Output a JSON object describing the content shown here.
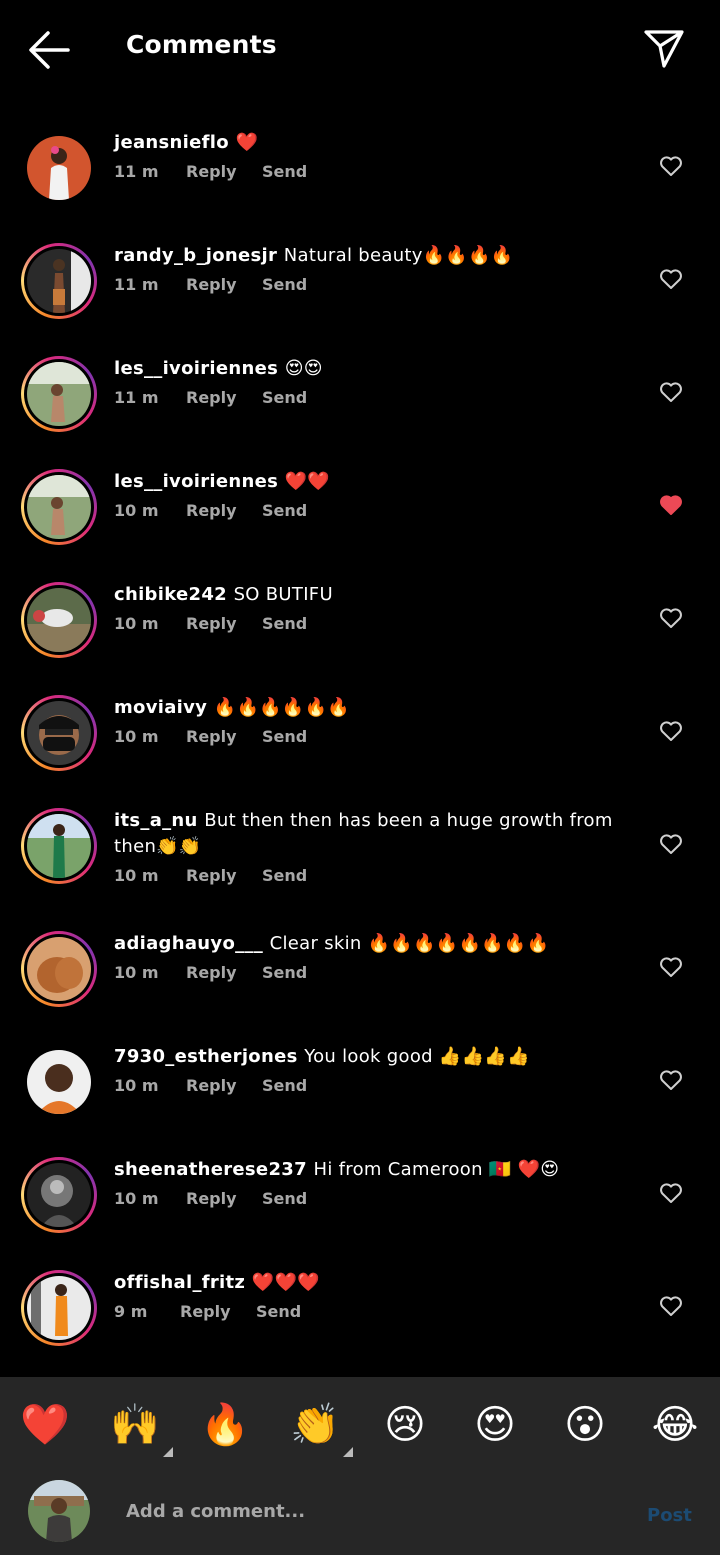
{
  "header": {
    "title": "Comments",
    "back_icon": "arrow-left-icon",
    "share_icon": "paper-plane-icon"
  },
  "comments": [
    {
      "user": "jeansnieflo",
      "text": "❤️",
      "time": "11 m",
      "reply": "Reply",
      "send": "Send",
      "liked": false,
      "ring": false
    },
    {
      "user": "randy_b_jonesjr",
      "text": "Natural beauty🔥🔥🔥🔥",
      "time": "11 m",
      "reply": "Reply",
      "send": "Send",
      "liked": false,
      "ring": true
    },
    {
      "user": "les__ivoiriennes",
      "text": "😍😍",
      "time": "11 m",
      "reply": "Reply",
      "send": "Send",
      "liked": false,
      "ring": true
    },
    {
      "user": "les__ivoiriennes",
      "text": "❤️❤️",
      "time": "10 m",
      "reply": "Reply",
      "send": "Send",
      "liked": true,
      "ring": true
    },
    {
      "user": "chibike242",
      "text": "SO BUTIFU",
      "time": "10 m",
      "reply": "Reply",
      "send": "Send",
      "liked": false,
      "ring": true
    },
    {
      "user": "moviaivy",
      "text": "🔥🔥🔥🔥🔥🔥",
      "time": "10 m",
      "reply": "Reply",
      "send": "Send",
      "liked": false,
      "ring": true
    },
    {
      "user": "its_a_nu",
      "text": "But then then has been a huge growth from then👏👏",
      "time": "10 m",
      "reply": "Reply",
      "send": "Send",
      "liked": false,
      "ring": true
    },
    {
      "user": "adiaghauyo___",
      "text": "Clear skin 🔥🔥🔥🔥🔥🔥🔥🔥",
      "time": "10 m",
      "reply": "Reply",
      "send": "Send",
      "liked": false,
      "ring": true
    },
    {
      "user": "7930_estherjones",
      "text": "You look good 👍👍👍👍",
      "time": "10 m",
      "reply": "Reply",
      "send": "Send",
      "liked": false,
      "ring": false
    },
    {
      "user": "sheenatherese237",
      "text": "Hi from Cameroon 🇨🇲 ❤️😍",
      "time": "10 m",
      "reply": "Reply",
      "send": "Send",
      "liked": false,
      "ring": true
    },
    {
      "user": "offishal_fritz",
      "text": "❤️❤️❤️",
      "time": "9 m",
      "reply": "Reply",
      "send": "Send",
      "liked": false,
      "ring": true
    }
  ],
  "emoji_bar": [
    "❤️",
    "🙌",
    "🔥",
    "👏",
    "😢",
    "😍",
    "😮",
    "😂"
  ],
  "composer": {
    "placeholder": "Add a comment...",
    "post_label": "Post"
  },
  "colors": {
    "background": "#000000",
    "panel": "#262626",
    "meta_text": "#a8a8a8",
    "liked_heart": "#ed4956",
    "post_disabled": "#1c4b73"
  }
}
